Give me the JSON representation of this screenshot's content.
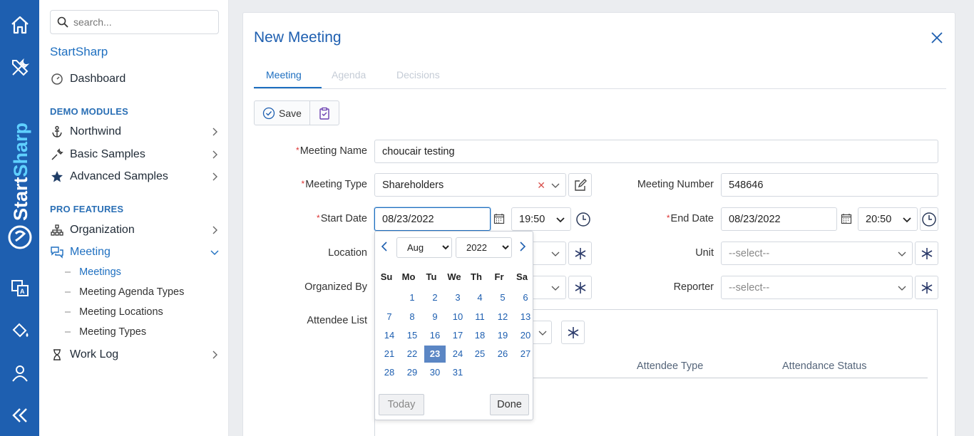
{
  "sidebar": {
    "search_placeholder": "search...",
    "brand": "StartSharp",
    "dashboard": "Dashboard",
    "section_demo": "DEMO MODULES",
    "northwind": "Northwind",
    "basic_samples": "Basic Samples",
    "advanced_samples": "Advanced Samples",
    "section_pro": "PRO FEATURES",
    "organization": "Organization",
    "meeting": "Meeting",
    "sub": [
      "Meetings",
      "Meeting Agenda Types",
      "Meeting Locations",
      "Meeting Types"
    ],
    "work_log": "Work Log",
    "rail_brand": "StartSharp"
  },
  "dialog": {
    "title": "New Meeting",
    "tabs": [
      "Meeting",
      "Agenda",
      "Decisions"
    ],
    "save_label": "Save"
  },
  "form": {
    "meeting_name_label": "Meeting Name",
    "meeting_name_value": "choucair testing",
    "meeting_type_label": "Meeting Type",
    "meeting_type_value": "Shareholders",
    "meeting_number_label": "Meeting Number",
    "meeting_number_value": "548646",
    "start_date_label": "Start Date",
    "start_date_value": "08/23/2022",
    "start_time_value": "19:50",
    "end_date_label": "End Date",
    "end_date_value": "08/23/2022",
    "end_time_value": "20:50",
    "location_label": "Location",
    "unit_label": "Unit",
    "unit_placeholder": "--select--",
    "organized_by_label": "Organized By",
    "reporter_label": "Reporter",
    "reporter_placeholder": "--select--",
    "attendee_list_label": "Attendee List",
    "col_attendee_type": "Attendee Type",
    "col_attendance_status": "Attendance Status"
  },
  "datepicker": {
    "month": "Aug",
    "year": "2022",
    "dow": [
      "Su",
      "Mo",
      "Tu",
      "We",
      "Th",
      "Fr",
      "Sa"
    ],
    "weeks": [
      [
        "",
        "1",
        "2",
        "3",
        "4",
        "5",
        "6"
      ],
      [
        "7",
        "8",
        "9",
        "10",
        "11",
        "12",
        "13"
      ],
      [
        "14",
        "15",
        "16",
        "17",
        "18",
        "19",
        "20"
      ],
      [
        "21",
        "22",
        "23",
        "24",
        "25",
        "26",
        "27"
      ],
      [
        "28",
        "29",
        "30",
        "31",
        "",
        "",
        ""
      ]
    ],
    "selected": "23",
    "today_label": "Today",
    "done_label": "Done"
  }
}
